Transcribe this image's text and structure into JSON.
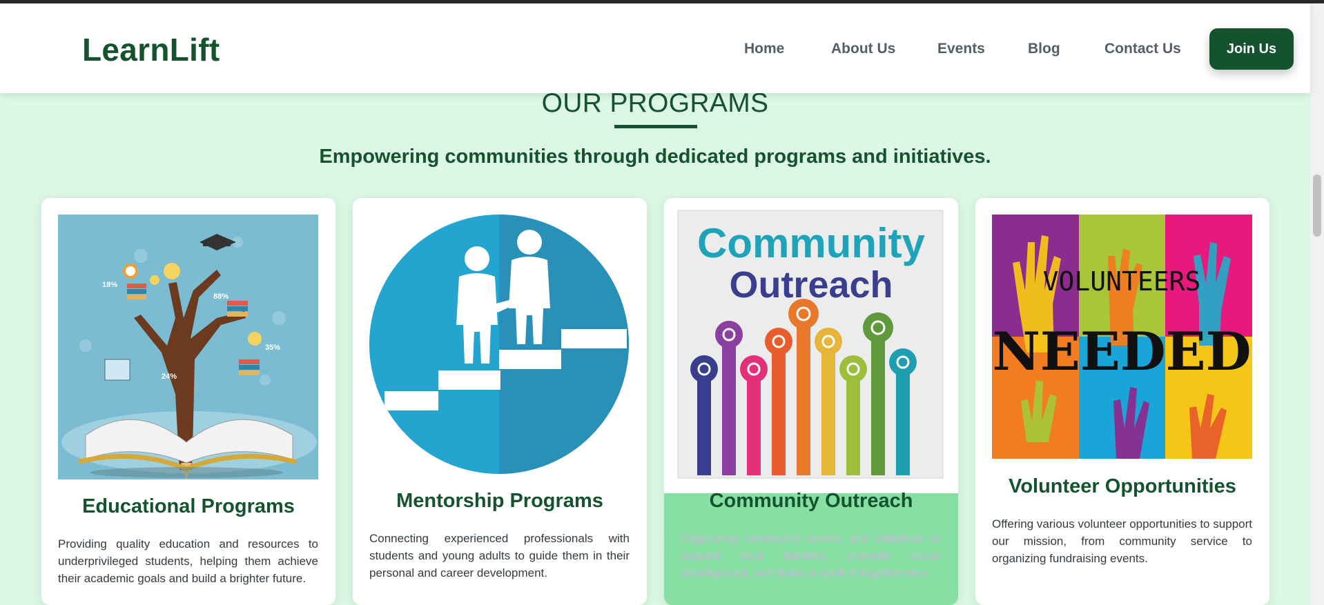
{
  "nav": {
    "logo": "LearnLift",
    "links": [
      "Home",
      "About Us",
      "Events",
      "Blog",
      "Contact Us"
    ],
    "cta": "Join Us"
  },
  "section": {
    "title": "OUR PROGRAMS",
    "subtitle": "Empowering communities through dedicated programs and initiatives."
  },
  "cards": [
    {
      "title": "Educational Programs",
      "description": "Providing quality education and resources to underprivileged students, helping them achieve their academic goals and build a brighter future.",
      "image_labels": [
        "18%",
        "88%",
        "35%",
        "24%"
      ]
    },
    {
      "title": "Mentorship Programs",
      "description": "Connecting experienced professionals with students and young adults to guide them in their personal and career development."
    },
    {
      "title": "Community Outreach",
      "description": "Organizing community events and initiatives to support local families, promote social development, and foster a spirit of togetherness.",
      "image_text": [
        "Community",
        "Outreach"
      ]
    },
    {
      "title": "Volunteer Opportunities",
      "description": "Offering various volunteer opportunities to support our mission, from community service to organizing fundraising events.",
      "image_text": [
        "VOLUNTEERS",
        "NEEDED"
      ]
    }
  ],
  "colors": {
    "brand": "#14532d",
    "page_bg": "#dcf7e4",
    "highlight_card": "#86e0a4"
  }
}
